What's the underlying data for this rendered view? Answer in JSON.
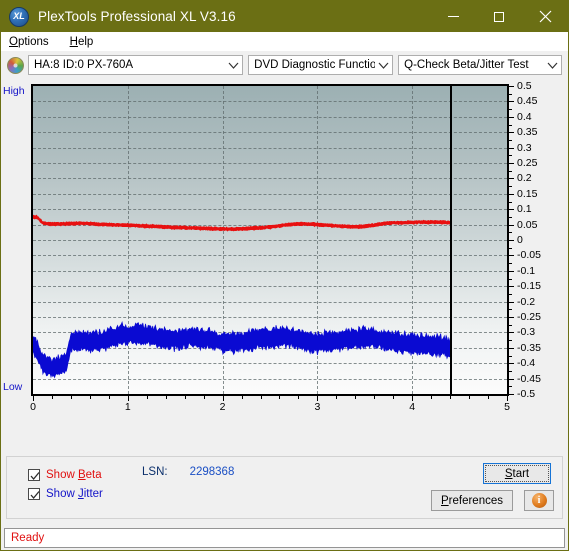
{
  "window": {
    "title": "PlexTools Professional XL V3.16",
    "icon_label": "XL",
    "minimize_label": "–",
    "maximize_label": "□",
    "close_label": "✕",
    "titlebar_color": "#6b6f14"
  },
  "menubar": {
    "items": [
      {
        "label": "Options",
        "accel": "O"
      },
      {
        "label": "Help",
        "accel": "H"
      }
    ]
  },
  "toolbar": {
    "drive_select": {
      "value": "HA:8 ID:0  PX-760A",
      "icon": "disc-icon"
    },
    "function_select": {
      "value": "DVD Diagnostic Functions"
    },
    "test_select": {
      "value": "Q-Check Beta/Jitter Test"
    }
  },
  "chart_labels": {
    "high": "High",
    "low": "Low"
  },
  "controls": {
    "show_beta": {
      "label": "Show Beta",
      "checked": true,
      "color": "#e01010"
    },
    "show_jitter": {
      "label": "Show Jitter",
      "checked": true,
      "color": "#1414c8"
    },
    "lsn_key": "LSN:",
    "lsn_value": "2298368",
    "start_label": "Start",
    "preferences_label": "Preferences",
    "info_label": "i"
  },
  "status": {
    "text": "Ready",
    "color": "#e01010"
  },
  "chart_data": {
    "type": "line",
    "title": "Q-Check Beta/Jitter Test",
    "xlabel": "",
    "ylabel": "",
    "xlim": [
      0,
      5
    ],
    "ylim": [
      -0.5,
      0.5
    ],
    "grid": true,
    "legend_position": "bottom-left",
    "x_ticks": [
      0,
      1,
      2,
      3,
      4,
      5
    ],
    "y_ticks": [
      0.5,
      0.45,
      0.4,
      0.35,
      0.3,
      0.25,
      0.2,
      0.15,
      0.1,
      0.05,
      0,
      -0.05,
      -0.1,
      -0.15,
      -0.2,
      -0.25,
      -0.3,
      -0.35,
      -0.4,
      -0.45,
      -0.5
    ],
    "y_axis_top_label": "High",
    "y_axis_bottom_label": "Low",
    "data_end_x": 4.4,
    "cursor_x": 4.4,
    "series": [
      {
        "name": "Beta",
        "color": "#e81010",
        "x": [
          0.0,
          0.05,
          0.1,
          0.15,
          0.2,
          0.3,
          0.4,
          0.5,
          0.6,
          0.7,
          0.8,
          0.9,
          1.0,
          1.1,
          1.2,
          1.3,
          1.4,
          1.5,
          1.6,
          1.7,
          1.8,
          1.9,
          2.0,
          2.1,
          2.2,
          2.3,
          2.4,
          2.5,
          2.6,
          2.7,
          2.8,
          2.9,
          3.0,
          3.1,
          3.2,
          3.3,
          3.4,
          3.5,
          3.6,
          3.7,
          3.8,
          3.9,
          4.0,
          4.1,
          4.2,
          4.3,
          4.4
        ],
        "values": [
          0.075,
          0.073,
          0.055,
          0.053,
          0.052,
          0.052,
          0.053,
          0.055,
          0.053,
          0.051,
          0.05,
          0.049,
          0.048,
          0.047,
          0.045,
          0.044,
          0.042,
          0.041,
          0.04,
          0.039,
          0.038,
          0.037,
          0.036,
          0.035,
          0.036,
          0.038,
          0.04,
          0.042,
          0.046,
          0.05,
          0.052,
          0.052,
          0.05,
          0.048,
          0.046,
          0.044,
          0.043,
          0.044,
          0.048,
          0.054,
          0.056,
          0.056,
          0.057,
          0.058,
          0.058,
          0.058,
          0.057
        ],
        "noise_amplitude": 0.006
      },
      {
        "name": "Jitter",
        "color": "#0a0ad2",
        "x": [
          0.0,
          0.05,
          0.1,
          0.15,
          0.2,
          0.25,
          0.3,
          0.35,
          0.4,
          0.5,
          0.6,
          0.7,
          0.8,
          0.9,
          1.0,
          1.1,
          1.2,
          1.3,
          1.4,
          1.5,
          1.6,
          1.7,
          1.8,
          1.9,
          2.0,
          2.1,
          2.2,
          2.3,
          2.4,
          2.5,
          2.6,
          2.7,
          2.8,
          2.9,
          3.0,
          3.1,
          3.2,
          3.3,
          3.4,
          3.5,
          3.6,
          3.7,
          3.8,
          3.9,
          4.0,
          4.1,
          4.2,
          4.3,
          4.4
        ],
        "values": [
          -0.335,
          -0.36,
          -0.4,
          -0.41,
          -0.415,
          -0.41,
          -0.405,
          -0.4,
          -0.33,
          -0.325,
          -0.33,
          -0.33,
          -0.32,
          -0.31,
          -0.305,
          -0.305,
          -0.31,
          -0.315,
          -0.32,
          -0.325,
          -0.32,
          -0.315,
          -0.322,
          -0.325,
          -0.332,
          -0.335,
          -0.33,
          -0.325,
          -0.32,
          -0.318,
          -0.315,
          -0.315,
          -0.322,
          -0.33,
          -0.335,
          -0.33,
          -0.325,
          -0.322,
          -0.32,
          -0.318,
          -0.32,
          -0.325,
          -0.33,
          -0.335,
          -0.338,
          -0.34,
          -0.342,
          -0.345,
          -0.348
        ],
        "noise_amplitude": 0.035
      }
    ]
  }
}
